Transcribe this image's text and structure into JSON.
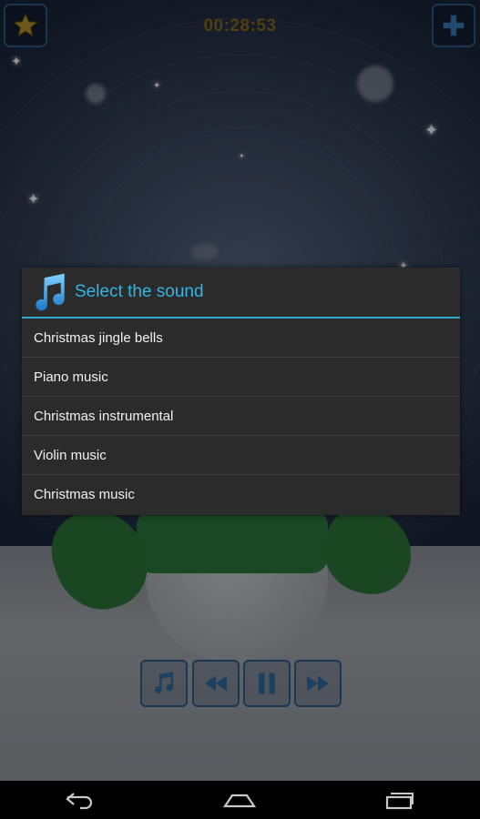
{
  "header": {
    "timer": "00:28:53",
    "left_button_icon": "star-icon",
    "right_button_icon": "plus-icon"
  },
  "dialog": {
    "icon": "music-note-icon",
    "title": "Select the sound",
    "items": [
      {
        "label": "Christmas jingle bells"
      },
      {
        "label": "Piano music"
      },
      {
        "label": "Christmas instrumental"
      },
      {
        "label": "Violin music"
      },
      {
        "label": "Christmas music"
      }
    ]
  },
  "player_controls": [
    {
      "icon": "music-note-icon"
    },
    {
      "icon": "rewind-icon"
    },
    {
      "icon": "pause-icon"
    },
    {
      "icon": "fast-forward-icon"
    }
  ],
  "navbar": [
    {
      "icon": "back-icon"
    },
    {
      "icon": "home-icon"
    },
    {
      "icon": "recent-apps-icon"
    }
  ],
  "colors": {
    "accent": "#33b5e5",
    "timer": "#8a6a1c",
    "button_border": "#2c5c8f",
    "dialog_bg": "#2b2b2b"
  }
}
